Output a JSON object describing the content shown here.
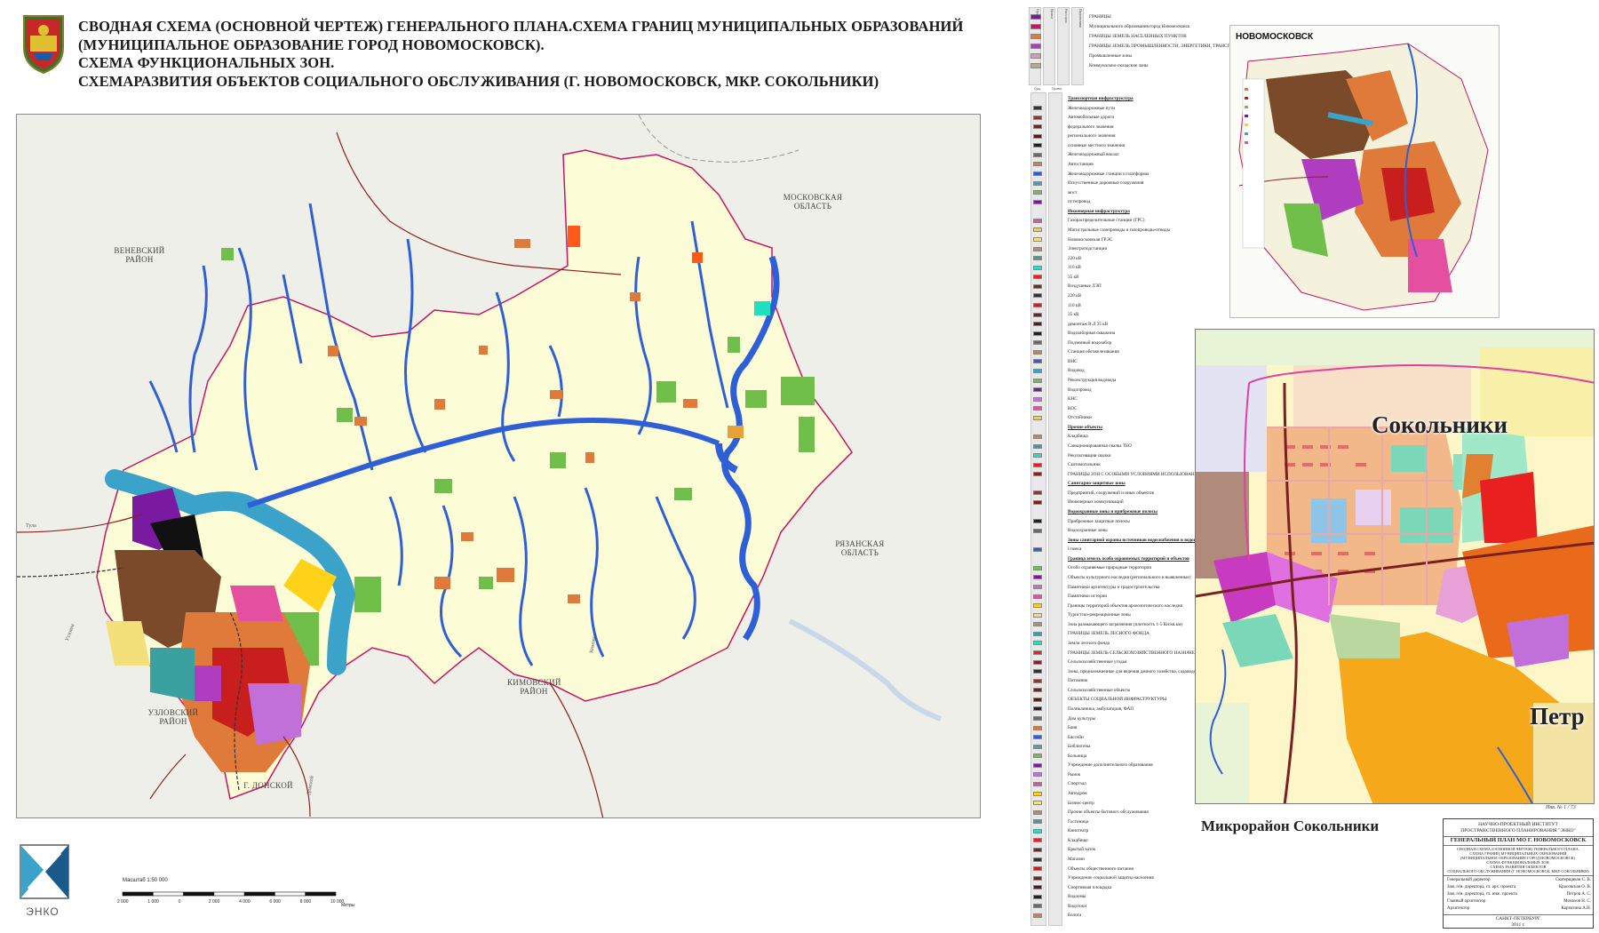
{
  "title": {
    "line1": "СВОДНАЯ СХЕМА (ОСНОВНОЙ ЧЕРТЕЖ) ГЕНЕРАЛЬНОГО ПЛАНА.СХЕМА ГРАНИЦ МУНИЦИПАЛЬНЫХ ОБРАЗОВАНИЙ",
    "line2": "(МУНИЦИПАЛЬНОЕ ОБРАЗОВАНИЕ ГОРОД НОВОМОСКОВСК).",
    "line3": "СХЕМА ФУНКЦИОНАЛЬНЫХ ЗОН.",
    "line4": "СХЕМАРАЗВИТИЯ ОБЪЕКТОВ СОЦИАЛЬНОГО ОБСЛУЖИВАНИЯ (Г. НОВОМОСКОВСК, МКР. СОКОЛЬНИКИ)"
  },
  "main_map": {
    "regions": {
      "moskovskaya": "МОСКОВСКАЯ ОБЛАСТЬ",
      "venevsky": "ВЕНЕВСКИЙ РАЙОН",
      "ryazanskaya": "РЯЗАНСКАЯ ОБЛАСТЬ",
      "kimovsky": "КИМОВСКИЙ РАЙОН",
      "uzlovsky": "УЗЛОВСКИЙ РАЙОН",
      "donskoy": "Г. ДОНСКОЙ"
    },
    "roads": {
      "tula": "Тула",
      "uzlovaya": "Узловая",
      "donskoy_road": "Донской",
      "kimovsk": "Кимовск"
    }
  },
  "legend_top": {
    "headers": [
      "Сущ.",
      "Проект",
      "Расч.срок",
      "Перспектива"
    ],
    "items": [
      {
        "label": "ГРАНИЦЫ",
        "bold": false
      },
      {
        "label": "Муниципального образования город Новомосковск",
        "bold": false
      },
      {
        "label": "ГРАНИЦЫ ЗЕМЕЛЬ НАСЕЛЕННЫХ ПУНКТОВ",
        "bold": false
      },
      {
        "label": "ГРАНИЦЫ ЗЕМЕЛЬ ПРОМЫШЛЕННОСТИ, ЭНЕРГЕТИКИ, ТРАНСПОРТА И ЗЕМЕЛЬ ИНОГО СПЕЦИАЛЬНОГО НАЗНАЧЕНИЯ",
        "bold": false
      },
      {
        "label": "Промышленные зоны",
        "bold": false
      },
      {
        "label": "Коммунально-складские зоны",
        "bold": false
      }
    ]
  },
  "legend_main": {
    "headers": [
      "Сущ.",
      "Проект"
    ],
    "items": [
      {
        "label": "Транспортная инфраструктура",
        "head": true
      },
      {
        "label": "Железнодорожные пути",
        "head": false
      },
      {
        "label": "Автомобильные дороги",
        "head": false
      },
      {
        "label": "федерального значения",
        "head": false
      },
      {
        "label": "регионального значения",
        "head": false
      },
      {
        "label": "основные местного значения",
        "head": false
      },
      {
        "label": "Железнодорожный вокзал",
        "head": false
      },
      {
        "label": "Автостанция",
        "head": false
      },
      {
        "label": "Железнодорожные станции и платформы",
        "head": false
      },
      {
        "label": "Искусственные дорожные сооружения",
        "head": false
      },
      {
        "label": "мост",
        "head": false
      },
      {
        "label": "путепровод",
        "head": false
      },
      {
        "label": "Инженерная инфраструктура",
        "head": true
      },
      {
        "label": "Газораспределительные станции (ГРС)",
        "head": false
      },
      {
        "label": "Магистральные газопроводы и газопроводы-отводы",
        "head": false
      },
      {
        "label": "Новомосковская ГРЭС",
        "head": false
      },
      {
        "label": "Электроподстанции",
        "head": false
      },
      {
        "label": "220 кВ",
        "head": false
      },
      {
        "label": "110 кВ",
        "head": false
      },
      {
        "label": "35 кВ",
        "head": false
      },
      {
        "label": "Воздушные ЛЭП",
        "head": false
      },
      {
        "label": "220 кВ",
        "head": false
      },
      {
        "label": "110 кВ",
        "head": false
      },
      {
        "label": "35 кВ",
        "head": false
      },
      {
        "label": "демонтаж В.Л 35 кВ",
        "head": false
      },
      {
        "label": "Водозаборная скважина",
        "head": false
      },
      {
        "label": "Подземный водозабор",
        "head": false
      },
      {
        "label": "Станция обезжелезивания",
        "head": false
      },
      {
        "label": "ВНС",
        "head": false
      },
      {
        "label": "Водовод",
        "head": false
      },
      {
        "label": "Реконструкция водовода",
        "head": false
      },
      {
        "label": "Водопровод",
        "head": false
      },
      {
        "label": "КНС",
        "head": false
      },
      {
        "label": "КОС",
        "head": false
      },
      {
        "label": "Отстойники",
        "head": false
      },
      {
        "label": "Прочие объекты",
        "head": true
      },
      {
        "label": "Кладбища",
        "head": false
      },
      {
        "label": "Санкционированная свалка ТБО",
        "head": false
      },
      {
        "label": "Рекультивация свалки",
        "head": false
      },
      {
        "label": "Скотомогильник",
        "head": false
      },
      {
        "label": "ГРАНИЦЫ ЗОН С ОСОБЫМИ УСЛОВИЯМИ ИСПОЛЬЗОВАНИЯ ТЕРРИТОРИИ",
        "head": false
      },
      {
        "label": "Санитарно-защитные зоны",
        "head": true
      },
      {
        "label": "Предприятий, сооружений и иных объектов",
        "head": false
      },
      {
        "label": "Инженерных коммуникаций",
        "head": false
      },
      {
        "label": "Водоохранные зоны и прибрежные полосы",
        "head": true
      },
      {
        "label": "Прибрежные защитные полосы",
        "head": false
      },
      {
        "label": "Водоохранные зоны",
        "head": false
      },
      {
        "label": "Зоны санитарной охраны источников водоснабжения и водопроводов питьевого назначения",
        "head": true
      },
      {
        "label": "I пояса",
        "head": false
      },
      {
        "label": "Граница земель особо охраняемых территорий и объектов",
        "head": true
      },
      {
        "label": "Особо охраняемые природные территории",
        "head": false
      },
      {
        "label": "Объекты культурного наследия (регионального и выявленные)",
        "head": false
      },
      {
        "label": "Памятники архитектуры и градостроительства",
        "head": false
      },
      {
        "label": "Памятники истории",
        "head": false
      },
      {
        "label": "Границы территорий объектов археологического наследия",
        "head": false
      },
      {
        "label": "Туристско-рекреационные зоны",
        "head": false
      },
      {
        "label": "Зона размыкающего загрязнения (плотность 1-5 Ки/кв.км)",
        "head": false
      },
      {
        "label": "ГРАНИЦЫ ЗЕМЕЛЬ ЛЕСНОГО ФОНДА",
        "head": false
      },
      {
        "label": "Земли лесного фонда",
        "head": false
      },
      {
        "label": "ГРАНИЦЫ ЗЕМЕЛЬ СЕЛЬСКОХОЗЯЙСТВЕННОГО НАЗНАЧЕНИЯ",
        "head": false
      },
      {
        "label": "Сельскохозяйственные угодья",
        "head": false
      },
      {
        "label": "Зоны, предназначенные для ведения дачного хозяйства, садоводства",
        "head": false
      },
      {
        "label": "Питомник",
        "head": false
      },
      {
        "label": "Сельскохозяйственные объекты",
        "head": false
      },
      {
        "label": "ОБЪЕКТЫ СОЦИАЛЬНОЙ ИНФРАСТРУКТУРЫ",
        "head": false
      },
      {
        "label": "Поликлиника, амбулатория, ФАП",
        "head": false
      },
      {
        "label": "Дом культуры",
        "head": false
      },
      {
        "label": "Баня",
        "head": false
      },
      {
        "label": "Бассейн",
        "head": false
      },
      {
        "label": "Библиотека",
        "head": false
      },
      {
        "label": "Больница",
        "head": false
      },
      {
        "label": "Учреждение дополнительного образования",
        "head": false
      },
      {
        "label": "Рынок",
        "head": false
      },
      {
        "label": "Спортзал",
        "head": false
      },
      {
        "label": "Автодром",
        "head": false
      },
      {
        "label": "Бизнес-центр",
        "head": false
      },
      {
        "label": "Прочие объекты бытового обслуживания",
        "head": false
      },
      {
        "label": "Гостиница",
        "head": false
      },
      {
        "label": "Кинотеатр",
        "head": false
      },
      {
        "label": "Кладбище",
        "head": false
      },
      {
        "label": "Крытый каток",
        "head": false
      },
      {
        "label": "Магазин",
        "head": false
      },
      {
        "label": "Объекты общественного питания",
        "head": false
      },
      {
        "label": "Учреждение социальной защиты населения",
        "head": false
      },
      {
        "label": "Спортивная площадка",
        "head": false
      },
      {
        "label": "Водоемы",
        "head": false
      },
      {
        "label": "Водотоки",
        "head": false
      },
      {
        "label": "Болота",
        "head": false
      }
    ]
  },
  "overview": {
    "title": "НОВОМОСКОВСК"
  },
  "detail": {
    "label_sokolniki": "Сокольники",
    "label_petr": "Петр",
    "caption": "Микрорайон Сокольники",
    "sheet_no": "Инв. № 1 / 73"
  },
  "stamp": {
    "org1": "НАУЧНО-ПРОЕКТНЫЙ ИНСТИТУТ",
    "org2": "ПРОСТРАНСТВЕННОГО ПЛАНИРОВАНИЯ \"ЭНКО\"",
    "project": "ГЕНЕРАЛЬНЫЙ ПЛАН МО Г. НОВОМОСКОВСК",
    "desc1": "СВОДНАЯ СХЕМА (ОСНОВНОЙ ЧЕРТЕЖ) ГЕНЕРАЛЬНОГО ПЛАНА.",
    "desc2": "СХЕМА ГРАНИЦ МУНИЦИПАЛЬНЫХ ОБРАЗОВАНИЙ",
    "desc3": "(МУНИЦИПАЛЬНОЕ ОБРАЗОВАНИЕ ГОРОД НОВОМОСКОВСК).",
    "desc4": "СХЕМА ФУНКЦИОНАЛЬНЫХ ЗОН.",
    "desc5": "СХЕМА РАЗВИТИЯ ОБЪЕКТОВ",
    "desc6": "СОЦИАЛЬНОГО ОБСЛУЖИВАНИЯ (Г. НОВОМОСКОВСК, МКР. СОКОЛЬНИКИ)",
    "people": [
      {
        "role": "Генеральный директор",
        "name": "Скатерщиков С. В."
      },
      {
        "role": "Зам. ген. директора, гл. арх. проекта",
        "name": "Красовская О. В."
      },
      {
        "role": "Зам. ген. директора, гл. инж. проекта",
        "name": "Петров А. С."
      },
      {
        "role": "Главный архитектор",
        "name": "Монахов Н. С."
      },
      {
        "role": "Архитектор",
        "name": "Карпатина А.Н."
      }
    ],
    "city": "САНКТ-ПЕТЕРБУРГ",
    "year": "2011 г."
  },
  "logo": {
    "text": "ЭНКО"
  },
  "scale": {
    "label": "Масштаб 1:50 000",
    "ticks": [
      "2 000",
      "1 000",
      "0",
      "2 000",
      "4 000",
      "6 000",
      "8 000",
      "10 000"
    ],
    "unit": "Метры"
  },
  "colors": {
    "water": "#2f5fd6",
    "reservoir": "#3ba3c9",
    "agri": "#fbfbd2",
    "forest": "#6fbf4a",
    "city_residential": "#e07a3a",
    "industrial": "#7b4a2a",
    "purple": "#7a1aa0"
  }
}
